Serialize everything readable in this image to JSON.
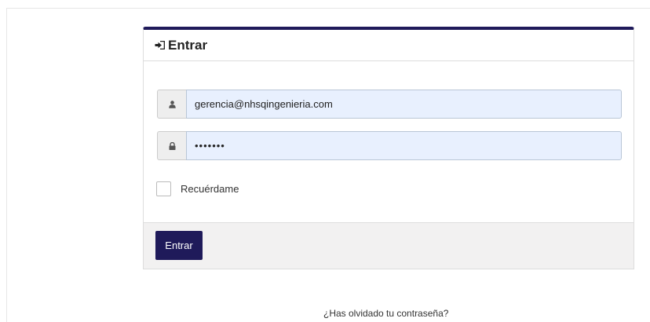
{
  "panel": {
    "title": "Entrar",
    "icon": "sign-in-icon"
  },
  "form": {
    "email": {
      "icon": "user-icon",
      "value": "gerencia@nhsqingenieria.com"
    },
    "password": {
      "icon": "lock-icon",
      "value": "•••••••"
    },
    "remember": {
      "label": "Recuérdame",
      "checked": false
    },
    "submit_label": "Entrar"
  },
  "forgot_password_link": "¿Has olvidado tu contraseña?",
  "colors": {
    "brand": "#1f1a5a",
    "input_autofill_bg": "#e8f0fe",
    "footer_bg": "#f2f1f1"
  }
}
